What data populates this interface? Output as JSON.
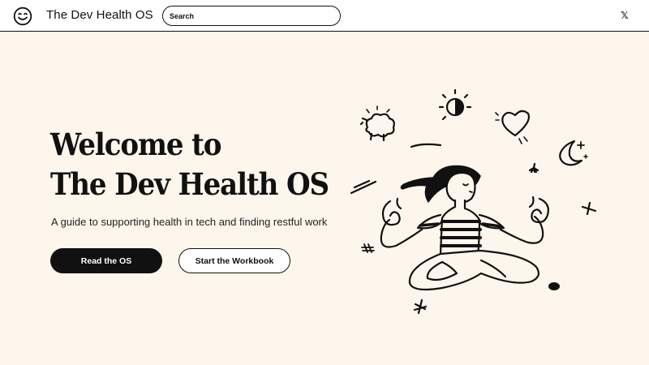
{
  "header": {
    "site_title": "The Dev Health OS",
    "search_placeholder": "Search",
    "social_link": "𝕏"
  },
  "hero": {
    "title_line1": "Welcome to",
    "title_line2": "The Dev Health OS",
    "subtitle": "A guide to supporting health in tech and finding restful work",
    "primary_button": "Read the OS",
    "secondary_button": "Start the Workbook"
  },
  "colors": {
    "background": "#fdf6ec",
    "header_background": "#ffffff",
    "ink": "#111111"
  },
  "icons": [
    "smiley-logo-icon",
    "x-social-icon",
    "meditation-illustration"
  ]
}
